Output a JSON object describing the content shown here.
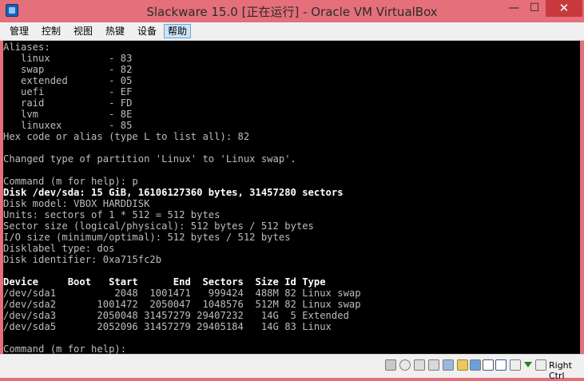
{
  "window": {
    "title": "Slackware 15.0 [正在运行] - Oracle VM VirtualBox",
    "min_glyph": "—",
    "max_glyph": "☐",
    "close_glyph": "✕"
  },
  "menu": {
    "items": [
      "管理",
      "控制",
      "视图",
      "热键",
      "设备",
      "帮助"
    ],
    "active": "帮助"
  },
  "terminal": {
    "lines": [
      {
        "text": "Aliases:",
        "bold": false
      },
      {
        "text": "   linux          - 83",
        "bold": false
      },
      {
        "text": "   swap           - 82",
        "bold": false
      },
      {
        "text": "   extended       - 05",
        "bold": false
      },
      {
        "text": "   uefi           - EF",
        "bold": false
      },
      {
        "text": "   raid           - FD",
        "bold": false
      },
      {
        "text": "   lvm            - 8E",
        "bold": false
      },
      {
        "text": "   linuxex        - 85",
        "bold": false
      },
      {
        "text": "Hex code or alias (type L to list all): 82",
        "bold": false
      },
      {
        "text": "",
        "bold": false
      },
      {
        "text": "Changed type of partition 'Linux' to 'Linux swap'.",
        "bold": false
      },
      {
        "text": "",
        "bold": false
      },
      {
        "text": "Command (m for help): p",
        "bold": false
      },
      {
        "text": "Disk /dev/sda: 15 GiB, 16106127360 bytes, 31457280 sectors",
        "bold": true
      },
      {
        "text": "Disk model: VBOX HARDDISK",
        "bold": false
      },
      {
        "text": "Units: sectors of 1 * 512 = 512 bytes",
        "bold": false
      },
      {
        "text": "Sector size (logical/physical): 512 bytes / 512 bytes",
        "bold": false
      },
      {
        "text": "I/O size (minimum/optimal): 512 bytes / 512 bytes",
        "bold": false
      },
      {
        "text": "Disklabel type: dos",
        "bold": false
      },
      {
        "text": "Disk identifier: 0xa715fc2b",
        "bold": false
      },
      {
        "text": "",
        "bold": false
      },
      {
        "text": "Device     Boot   Start      End  Sectors  Size Id Type",
        "bold": true
      },
      {
        "text": "/dev/sda1          2048  1001471   999424  488M 82 Linux swap",
        "bold": false
      },
      {
        "text": "/dev/sda2       1001472  2050047  1048576  512M 82 Linux swap",
        "bold": false
      },
      {
        "text": "/dev/sda3       2050048 31457279 29407232   14G  5 Extended",
        "bold": false
      },
      {
        "text": "/dev/sda5       2052096 31457279 29405184   14G 83 Linux",
        "bold": false
      },
      {
        "text": "",
        "bold": false
      },
      {
        "text": "Command (m for help): ",
        "bold": false
      }
    ]
  },
  "statusbar": {
    "icons": [
      "hdd-icon",
      "cd-icon",
      "audio-icon",
      "network-icon",
      "usb-icon",
      "shared-folder-icon",
      "display-icon",
      "recording-icon",
      "vt-x-icon",
      "mouse-integration-icon",
      "keyboard-capture-icon"
    ],
    "host_key": "Right Ctrl"
  },
  "colors": {
    "titlebar": "#e56f7a",
    "terminal_bg": "#000000",
    "terminal_fg": "#bdbdbd",
    "close_button": "#c7393c"
  }
}
